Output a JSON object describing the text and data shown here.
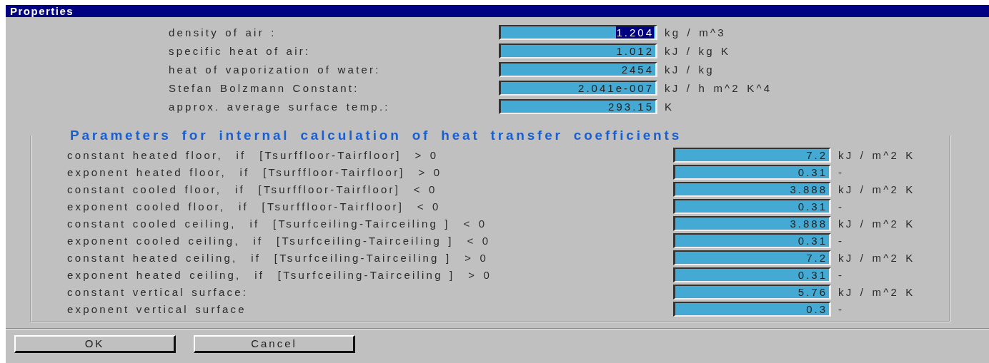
{
  "window": {
    "title": "Properties"
  },
  "constants": [
    {
      "label": "density of air :",
      "value": "1.204",
      "unit": "kg / m^3",
      "focused": true
    },
    {
      "label": "specific heat of air:",
      "value": "1.012",
      "unit": "kJ / kg K",
      "focused": false
    },
    {
      "label": "heat of vaporization of water:",
      "value": "2454",
      "unit": "kJ / kg",
      "focused": false
    },
    {
      "label": "Stefan Bolzmann Constant:",
      "value": "2.041e-007",
      "unit": "kJ / h m^2 K^4",
      "focused": false
    },
    {
      "label": "approx. average surface temp.:",
      "value": "293.15",
      "unit": "K",
      "focused": false
    }
  ],
  "group": {
    "title": "Parameters for internal calculation of heat transfer coefficients",
    "parameters": [
      {
        "label": "constant heated floor,  if  [Tsurffloor-Tairfloor]  > 0",
        "value": "7.2",
        "unit": "kJ / m^2 K",
        "focused": false
      },
      {
        "label": "exponent heated floor,  if  [Tsurffloor-Tairfloor]  > 0",
        "value": "0.31",
        "unit": "-",
        "focused": false
      },
      {
        "label": "constant cooled floor,  if  [Tsurffloor-Tairfloor]  < 0",
        "value": "3.888",
        "unit": "kJ / m^2 K",
        "focused": false
      },
      {
        "label": "exponent cooled floor,  if  [Tsurffloor-Tairfloor]  < 0",
        "value": "0.31",
        "unit": "-",
        "focused": false
      },
      {
        "label": "constant cooled ceiling,  if  [Tsurfceiling-Tairceiling ]  < 0",
        "value": "3.888",
        "unit": "kJ / m^2 K",
        "focused": false
      },
      {
        "label": "exponent cooled ceiling,  if  [Tsurfceiling-Tairceiling ]  < 0",
        "value": "0.31",
        "unit": "-",
        "focused": false
      },
      {
        "label": "constant heated ceiling,  if  [Tsurfceiling-Tairceiling ]  > 0",
        "value": "7.2",
        "unit": "kJ / m^2 K",
        "focused": false
      },
      {
        "label": "exponent heated ceiling,  if  [Tsurfceiling-Tairceiling ]  > 0",
        "value": "0.31",
        "unit": "-",
        "focused": false
      },
      {
        "label": "constant vertical surface:",
        "value": "5.76",
        "unit": "kJ / m^2 K",
        "focused": false
      },
      {
        "label": "exponent vertical surface",
        "value": "0.3",
        "unit": "-",
        "focused": false
      }
    ]
  },
  "buttons": [
    {
      "label": "OK"
    },
    {
      "label": "Cancel"
    }
  ]
}
